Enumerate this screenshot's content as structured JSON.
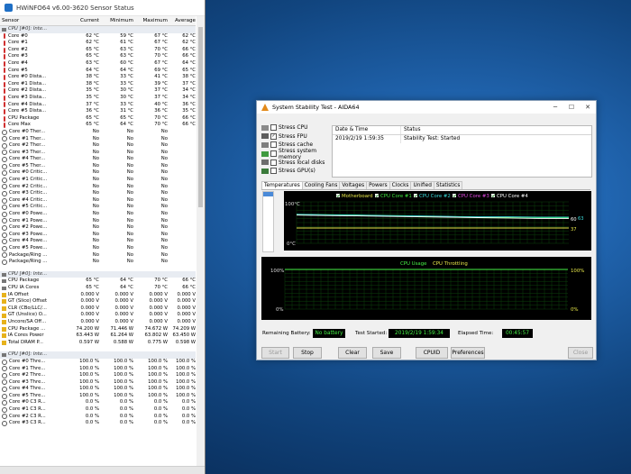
{
  "hwinfo": {
    "title": "HWiNFO64 v6.00-3620 Sensor Status",
    "headers": [
      "Sensor",
      "Current",
      "Minimum",
      "Maximum",
      "Average"
    ],
    "rows": [
      {
        "t": "group",
        "name": "CPU [#0]: Inte..."
      },
      {
        "t": "temp",
        "name": "Core #0",
        "cur": "62 °C",
        "min": "59 °C",
        "max": "67 °C",
        "avg": "62 °C"
      },
      {
        "t": "temp",
        "name": "Core #1",
        "cur": "62 °C",
        "min": "61 °C",
        "max": "67 °C",
        "avg": "62 °C"
      },
      {
        "t": "temp",
        "name": "Core #2",
        "cur": "65 °C",
        "min": "63 °C",
        "max": "70 °C",
        "avg": "66 °C"
      },
      {
        "t": "temp",
        "name": "Core #3",
        "cur": "65 °C",
        "min": "63 °C",
        "max": "70 °C",
        "avg": "66 °C"
      },
      {
        "t": "temp",
        "name": "Core #4",
        "cur": "63 °C",
        "min": "60 °C",
        "max": "67 °C",
        "avg": "64 °C"
      },
      {
        "t": "temp",
        "name": "Core #5",
        "cur": "64 °C",
        "min": "64 °C",
        "max": "69 °C",
        "avg": "65 °C"
      },
      {
        "t": "temp",
        "name": "Core #0 Dista...",
        "cur": "38 °C",
        "min": "33 °C",
        "max": "41 °C",
        "avg": "38 °C"
      },
      {
        "t": "temp",
        "name": "Core #1 Dista...",
        "cur": "38 °C",
        "min": "33 °C",
        "max": "39 °C",
        "avg": "37 °C"
      },
      {
        "t": "temp",
        "name": "Core #2 Dista...",
        "cur": "35 °C",
        "min": "30 °C",
        "max": "37 °C",
        "avg": "34 °C"
      },
      {
        "t": "temp",
        "name": "Core #3 Dista...",
        "cur": "35 °C",
        "min": "30 °C",
        "max": "37 °C",
        "avg": "34 °C"
      },
      {
        "t": "temp",
        "name": "Core #4 Dista...",
        "cur": "37 °C",
        "min": "33 °C",
        "max": "40 °C",
        "avg": "36 °C"
      },
      {
        "t": "temp",
        "name": "Core #5 Dista...",
        "cur": "36 °C",
        "min": "31 °C",
        "max": "36 °C",
        "avg": "35 °C"
      },
      {
        "t": "temp",
        "name": "CPU Package",
        "cur": "65 °C",
        "min": "65 °C",
        "max": "70 °C",
        "avg": "66 °C"
      },
      {
        "t": "temp",
        "name": "Core Max",
        "cur": "65 °C",
        "min": "64 °C",
        "max": "70 °C",
        "avg": "66 °C"
      },
      {
        "t": "clock",
        "name": "Core #0 Ther...",
        "cur": "No",
        "min": "No",
        "max": "No",
        "avg": ""
      },
      {
        "t": "clock",
        "name": "Core #1 Ther...",
        "cur": "No",
        "min": "No",
        "max": "No",
        "avg": ""
      },
      {
        "t": "clock",
        "name": "Core #2 Ther...",
        "cur": "No",
        "min": "No",
        "max": "No",
        "avg": ""
      },
      {
        "t": "clock",
        "name": "Core #3 Ther...",
        "cur": "No",
        "min": "No",
        "max": "No",
        "avg": ""
      },
      {
        "t": "clock",
        "name": "Core #4 Ther...",
        "cur": "No",
        "min": "No",
        "max": "No",
        "avg": ""
      },
      {
        "t": "clock",
        "name": "Core #5 Ther...",
        "cur": "No",
        "min": "No",
        "max": "No",
        "avg": ""
      },
      {
        "t": "clock",
        "name": "Core #0 Critic...",
        "cur": "No",
        "min": "No",
        "max": "No",
        "avg": ""
      },
      {
        "t": "clock",
        "name": "Core #1 Critic...",
        "cur": "No",
        "min": "No",
        "max": "No",
        "avg": ""
      },
      {
        "t": "clock",
        "name": "Core #2 Critic...",
        "cur": "No",
        "min": "No",
        "max": "No",
        "avg": ""
      },
      {
        "t": "clock",
        "name": "Core #3 Critic...",
        "cur": "No",
        "min": "No",
        "max": "No",
        "avg": ""
      },
      {
        "t": "clock",
        "name": "Core #4 Critic...",
        "cur": "No",
        "min": "No",
        "max": "No",
        "avg": ""
      },
      {
        "t": "clock",
        "name": "Core #5 Critic...",
        "cur": "No",
        "min": "No",
        "max": "No",
        "avg": ""
      },
      {
        "t": "clock",
        "name": "Core #0 Powe...",
        "cur": "No",
        "min": "No",
        "max": "No",
        "avg": ""
      },
      {
        "t": "clock",
        "name": "Core #1 Powe...",
        "cur": "No",
        "min": "No",
        "max": "No",
        "avg": ""
      },
      {
        "t": "clock",
        "name": "Core #2 Powe...",
        "cur": "No",
        "min": "No",
        "max": "No",
        "avg": ""
      },
      {
        "t": "clock",
        "name": "Core #3 Powe...",
        "cur": "No",
        "min": "No",
        "max": "No",
        "avg": ""
      },
      {
        "t": "clock",
        "name": "Core #4 Powe...",
        "cur": "No",
        "min": "No",
        "max": "No",
        "avg": ""
      },
      {
        "t": "clock",
        "name": "Core #5 Powe...",
        "cur": "No",
        "min": "No",
        "max": "No",
        "avg": ""
      },
      {
        "t": "clock",
        "name": "Package/Ring ...",
        "cur": "No",
        "min": "No",
        "max": "No",
        "avg": ""
      },
      {
        "t": "clock",
        "name": "Package/Ring ...",
        "cur": "No",
        "min": "No",
        "max": "No",
        "avg": ""
      },
      {
        "t": "spacer"
      },
      {
        "t": "group",
        "name": "CPU [#0]: Inte..."
      },
      {
        "t": "cpu",
        "name": "CPU Package",
        "cur": "65 °C",
        "min": "64 °C",
        "max": "70 °C",
        "avg": "66 °C"
      },
      {
        "t": "cpu",
        "name": "CPU IA Cores",
        "cur": "65 °C",
        "min": "64 °C",
        "max": "70 °C",
        "avg": "66 °C"
      },
      {
        "t": "power",
        "name": "IA Offset",
        "cur": "0.000 V",
        "min": "0.000 V",
        "max": "0.000 V",
        "avg": "0.000 V"
      },
      {
        "t": "power",
        "name": "GT (Slice) Offset",
        "cur": "0.000 V",
        "min": "0.000 V",
        "max": "0.000 V",
        "avg": "0.000 V"
      },
      {
        "t": "power",
        "name": "CLR (CBo/LLC/...",
        "cur": "0.000 V",
        "min": "0.000 V",
        "max": "0.000 V",
        "avg": "0.000 V"
      },
      {
        "t": "power",
        "name": "GT (Unslice) O...",
        "cur": "0.000 V",
        "min": "0.000 V",
        "max": "0.000 V",
        "avg": "0.000 V"
      },
      {
        "t": "power",
        "name": "Uncore/SA Off...",
        "cur": "0.000 V",
        "min": "0.000 V",
        "max": "0.000 V",
        "avg": "0.000 V"
      },
      {
        "t": "power",
        "name": "CPU Package ...",
        "cur": "74.200 W",
        "min": "71.446 W",
        "max": "74.672 W",
        "avg": "74.209 W"
      },
      {
        "t": "power",
        "name": "IA Cores Power",
        "cur": "63.443 W",
        "min": "61.264 W",
        "max": "63.802 W",
        "avg": "63.450 W"
      },
      {
        "t": "power",
        "name": "Total DRAM P...",
        "cur": "0.597 W",
        "min": "0.588 W",
        "max": "0.775 W",
        "avg": "0.598 W"
      },
      {
        "t": "spacer"
      },
      {
        "t": "group",
        "name": "CPU [#0]: Inte..."
      },
      {
        "t": "clock",
        "name": "Core #0 Thre...",
        "cur": "100.0 %",
        "min": "100.0 %",
        "max": "100.0 %",
        "avg": "100.0 %"
      },
      {
        "t": "clock",
        "name": "Core #1 Thre...",
        "cur": "100.0 %",
        "min": "100.0 %",
        "max": "100.0 %",
        "avg": "100.0 %"
      },
      {
        "t": "clock",
        "name": "Core #2 Thre...",
        "cur": "100.0 %",
        "min": "100.0 %",
        "max": "100.0 %",
        "avg": "100.0 %"
      },
      {
        "t": "clock",
        "name": "Core #3 Thre...",
        "cur": "100.0 %",
        "min": "100.0 %",
        "max": "100.0 %",
        "avg": "100.0 %"
      },
      {
        "t": "clock",
        "name": "Core #4 Thre...",
        "cur": "100.0 %",
        "min": "100.0 %",
        "max": "100.0 %",
        "avg": "100.0 %"
      },
      {
        "t": "clock",
        "name": "Core #5 Thre...",
        "cur": "100.0 %",
        "min": "100.0 %",
        "max": "100.0 %",
        "avg": "100.0 %"
      },
      {
        "t": "clock",
        "name": "Core #0 C3 R...",
        "cur": "0.0 %",
        "min": "0.0 %",
        "max": "0.0 %",
        "avg": "0.0 %"
      },
      {
        "t": "clock",
        "name": "Core #1 C3 R...",
        "cur": "0.0 %",
        "min": "0.0 %",
        "max": "0.0 %",
        "avg": "0.0 %"
      },
      {
        "t": "clock",
        "name": "Core #2 C3 R...",
        "cur": "0.0 %",
        "min": "0.0 %",
        "max": "0.0 %",
        "avg": "0.0 %"
      },
      {
        "t": "clock",
        "name": "Core #3 C3 R...",
        "cur": "0.0 %",
        "min": "0.0 %",
        "max": "0.0 %",
        "avg": "0.0 %"
      }
    ]
  },
  "aida": {
    "title": "System Stability Test - AIDA64",
    "stress": [
      {
        "label": "Stress CPU",
        "checked": false
      },
      {
        "label": "Stress FPU",
        "checked": true
      },
      {
        "label": "Stress cache",
        "checked": false
      },
      {
        "label": "Stress system memory",
        "checked": false
      },
      {
        "label": "Stress local disks",
        "checked": false
      },
      {
        "label": "Stress GPU(s)",
        "checked": false
      }
    ],
    "log": {
      "headers": [
        "Date & Time",
        "Status"
      ],
      "rows": [
        {
          "time": "2019/2/19 1:59:35",
          "status": "Stability Test: Started"
        }
      ]
    },
    "tabs": [
      "Temperatures",
      "Cooling Fans",
      "Voltages",
      "Powers",
      "Clocks",
      "Unified",
      "Statistics"
    ],
    "active_tab": "Temperatures",
    "legend": [
      {
        "label": "Motherboard",
        "color": "#e8e84a"
      },
      {
        "label": "CPU Core #1",
        "color": "#3ee23e"
      },
      {
        "label": "CPU Core #2",
        "color": "#3ad8d8"
      },
      {
        "label": "CPU Core #3",
        "color": "#e24ae2"
      },
      {
        "label": "CPU Core #4",
        "color": "#ffffff"
      }
    ],
    "temp_axis": {
      "top": "100°C",
      "bottom": "0°C"
    },
    "temp_values": {
      "v1": "60",
      "v2": "63",
      "v3": "37"
    },
    "usage_title": "CPU Usage",
    "usage_title2": "CPU Throttling",
    "usage_axis": {
      "top_left": "100%",
      "bottom_left": "0%",
      "top_right": "100%",
      "bottom_right": "0%"
    },
    "footer": {
      "battery_label": "Remaining Battery:",
      "battery_value": "No battery",
      "started_label": "Test Started:",
      "started_value": "2019/2/19 1:59:34",
      "elapsed_label": "Elapsed Time:",
      "elapsed_value": "00:45:57"
    },
    "buttons": {
      "start": "Start",
      "stop": "Stop",
      "clear": "Clear",
      "save": "Save",
      "cpuid": "CPUID",
      "preferences": "Preferences",
      "close": "Close"
    }
  },
  "chart_data": [
    {
      "type": "line",
      "title": "",
      "ylim": [
        0,
        100
      ],
      "series": [
        {
          "name": "Motherboard",
          "values": [
            37,
            37,
            37,
            37,
            37,
            37,
            37,
            37,
            37,
            37
          ]
        },
        {
          "name": "CPU Core #1",
          "values": [
            70,
            69,
            68,
            66,
            65,
            64,
            63,
            63,
            62,
            62
          ]
        },
        {
          "name": "CPU Core #2",
          "values": [
            70,
            69,
            68,
            67,
            66,
            65,
            64,
            64,
            63,
            63
          ]
        },
        {
          "name": "CPU Core #4",
          "values": [
            68,
            67,
            66,
            65,
            64,
            63,
            62,
            61,
            60,
            60
          ]
        }
      ]
    },
    {
      "type": "area",
      "title": "CPU Usage",
      "ylim": [
        0,
        100
      ],
      "series": [
        {
          "name": "CPU Usage",
          "values": [
            100,
            100,
            100,
            100,
            100,
            100,
            100,
            100,
            100,
            100
          ]
        }
      ]
    }
  ]
}
